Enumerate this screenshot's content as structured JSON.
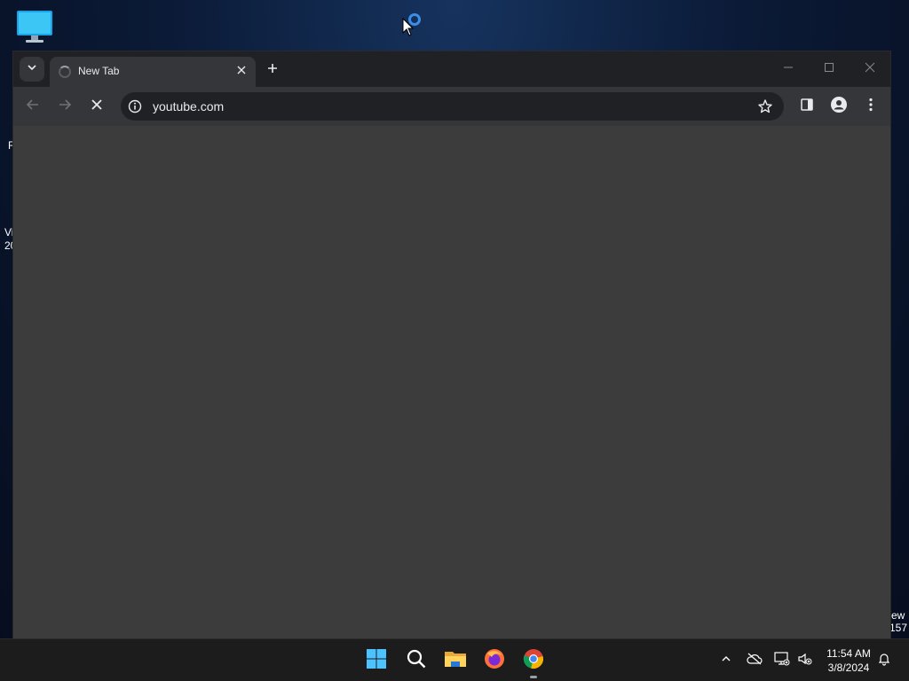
{
  "desktop": {
    "fragments": {
      "left_1": "R",
      "left_2": "Vi",
      "left_3": "20",
      "right_1": "ew",
      "right_2": "157"
    }
  },
  "browser": {
    "tab": {
      "title": "New Tab"
    },
    "omnibox": {
      "url": "youtube.com"
    }
  },
  "taskbar": {
    "apps": [
      "start-icon",
      "search-icon",
      "file-explorer-icon",
      "firefox-icon",
      "chrome-icon"
    ],
    "clock": {
      "time": "11:54 AM",
      "date": "3/8/2024"
    }
  },
  "colors": {
    "titlebar": "#202124",
    "toolbar": "#35363a",
    "content": "#3c3c3c",
    "accent": "#3b8ee8"
  }
}
